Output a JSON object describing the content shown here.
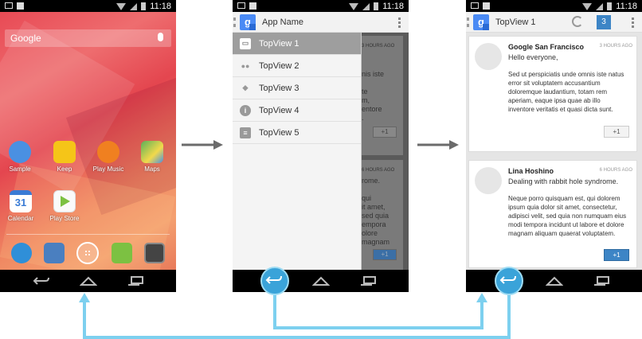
{
  "status_bar": {
    "time": "11:18"
  },
  "phone1": {
    "search_label": "Google",
    "apps": [
      {
        "label": "Sample",
        "color": "#4a90e2"
      },
      {
        "label": "Keep",
        "color": "#f5c518"
      },
      {
        "label": "Play Music",
        "color": "#f08020"
      },
      {
        "label": "Maps",
        "color": "#5ab05a"
      },
      {
        "label": "Calendar",
        "color": "#3a7bd5",
        "glyph": "31"
      },
      {
        "label": "Play Store",
        "color": "#7cc142"
      }
    ]
  },
  "phone2": {
    "app_title": "App Name",
    "logo_glyph": "g",
    "drawer_items": [
      {
        "label": "TopView 1"
      },
      {
        "label": "TopView 2"
      },
      {
        "label": "TopView 3"
      },
      {
        "label": "TopView 4"
      },
      {
        "label": "TopView 5"
      }
    ],
    "behind_fragments": {
      "card1_time": "3 HOURS AGO",
      "card1_lines": "nis iste\n\nte\nm,\nentore\n.",
      "card1_button": "+1",
      "card2_time": "6 HOURS AGO",
      "card2_lines": "rome.\n\nqui\nit amet,\nsed quia\nempora\nolore\nmagnam",
      "card2_button": "+1"
    }
  },
  "phone3": {
    "title": "TopView 1",
    "logo_glyph": "g",
    "count_badge": "3",
    "posts": [
      {
        "author": "Google San Francisco",
        "time": "3 HOURS AGO",
        "headline": "Hello everyone,",
        "body": "Sed ut perspiciatis unde omnis iste natus error sit voluptatem accusantium doloremque laudantium, totam rem aperiam, eaque ipsa quae ab illo inventore veritatis et quasi dicta sunt.",
        "plus": "+1"
      },
      {
        "author": "Lina Hoshino",
        "time": "6 HOURS AGO",
        "headline": "Dealing with rabbit hole syndrome.",
        "body": "Neque porro quisquam est, qui dolorem ipsum quia dolor sit amet, consectetur, adipisci velit, sed quia non numquam eius modi tempora incidunt ut labore et dolore magnam aliquam quaerat voluptatem.",
        "plus": "+1"
      }
    ]
  },
  "colors": {
    "flow_blue": "#7dd0ef",
    "back_circle": "#3aa3d9",
    "arrow_grey": "#6b6b6b"
  }
}
